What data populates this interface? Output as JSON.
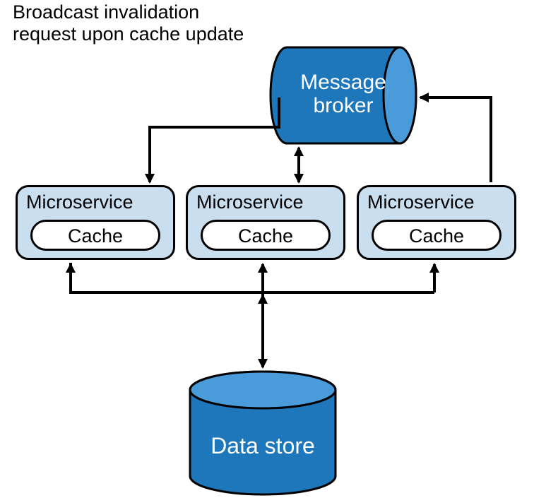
{
  "caption_line1": "Broadcast invalidation",
  "caption_line2": "request upon cache update",
  "broker_line1": "Message",
  "broker_line2": "broker",
  "datastore_label": "Data store",
  "ms_label": "Microservice",
  "cache_label": "Cache",
  "colors": {
    "cylinder_top": "#4a9bd9",
    "cylinder_side": "#1e76bb",
    "ms_bg": "#c9deef"
  }
}
